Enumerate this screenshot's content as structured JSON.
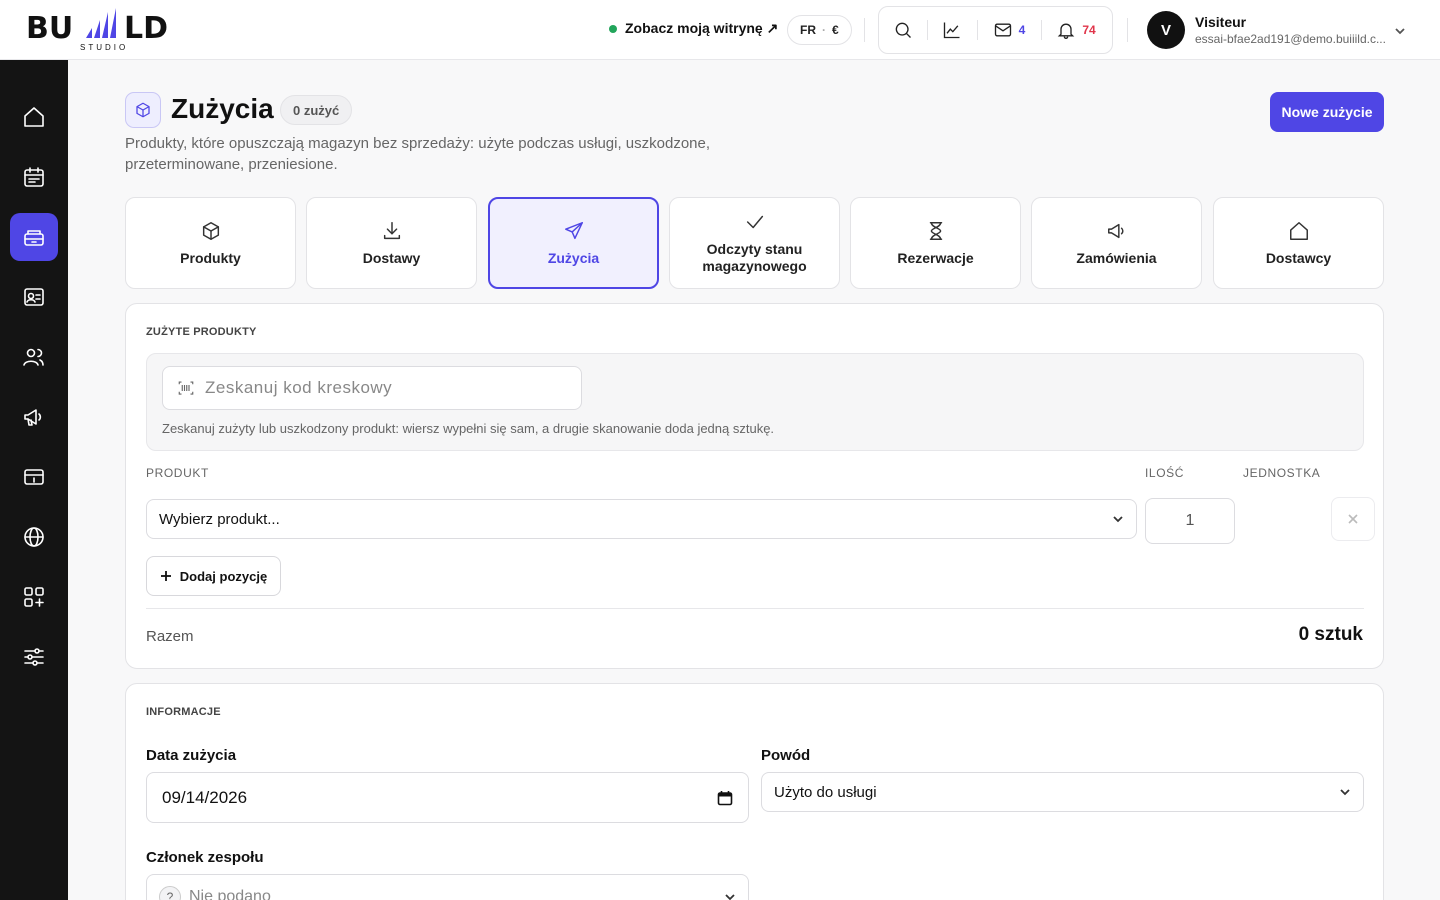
{
  "topbar": {
    "logo_text": "BU  LD",
    "logo_sub": "STUDIO",
    "site_link": "Zobacz moją witrynę ↗",
    "lang": "FR",
    "currency": "€",
    "mail_count": "4",
    "notif_count": "74",
    "user_initial": "V",
    "user_name": "Visiteur",
    "user_email": "essai-bfae2ad191@demo.buiiild.c..."
  },
  "sidebar": {
    "items": [
      "home-icon",
      "calendar-icon",
      "inventory-icon",
      "contact-card-icon",
      "users-icon",
      "megaphone-icon",
      "payment-card-icon",
      "globe-icon",
      "apps-add-icon",
      "settings-sliders-icon"
    ],
    "active_index": 2
  },
  "header": {
    "title": "Zużycia",
    "count_badge": "0 zużyć",
    "subtitle": "Produkty, które opuszczają magazyn bez sprzedaży: użyte podczas usługi, uszkodzone, przeterminowane, przeniesione.",
    "primary_button": "Nowe zużycie"
  },
  "tabs": [
    {
      "label": "Produkty",
      "icon": "box-icon"
    },
    {
      "label": "Dostawy",
      "icon": "download-icon"
    },
    {
      "label": "Zużycia",
      "icon": "send-icon",
      "active": true
    },
    {
      "label": "Odczyty stanu magazynowego",
      "icon": "check-icon"
    },
    {
      "label": "Rezerwacje",
      "icon": "hourglass-icon"
    },
    {
      "label": "Zamówienia",
      "icon": "megaphone-icon"
    },
    {
      "label": "Dostawcy",
      "icon": "home-icon"
    }
  ],
  "used_products": {
    "section_title": "ZUŻYTE PRODUKTY",
    "scan_placeholder": "Zeskanuj kod kreskowy",
    "scan_hint": "Zeskanuj zużyty lub uszkodzony produkt: wiersz wypełni się sam, a drugie skanowanie doda jedną sztukę.",
    "col_product": "PRODUKT",
    "col_qty": "ILOŚĆ",
    "col_unit": "JEDNOSTKA",
    "row": {
      "product_placeholder": "Wybierz produkt...",
      "qty": "1"
    },
    "add_button": "Dodaj pozycję",
    "total_label": "Razem",
    "total_value": "0 sztuk"
  },
  "info": {
    "section_title": "INFORMACJE",
    "date_label": "Data zużycia",
    "date_value": "09/14/2026",
    "reason_label": "Powód",
    "reason_value": "Użyto do usługi",
    "member_label": "Członek zespołu",
    "member_value": "Nie podano"
  },
  "colors": {
    "accent": "#4f46e5",
    "sidebar": "#141414",
    "notif": "#e0344a",
    "online": "#22a55b"
  }
}
